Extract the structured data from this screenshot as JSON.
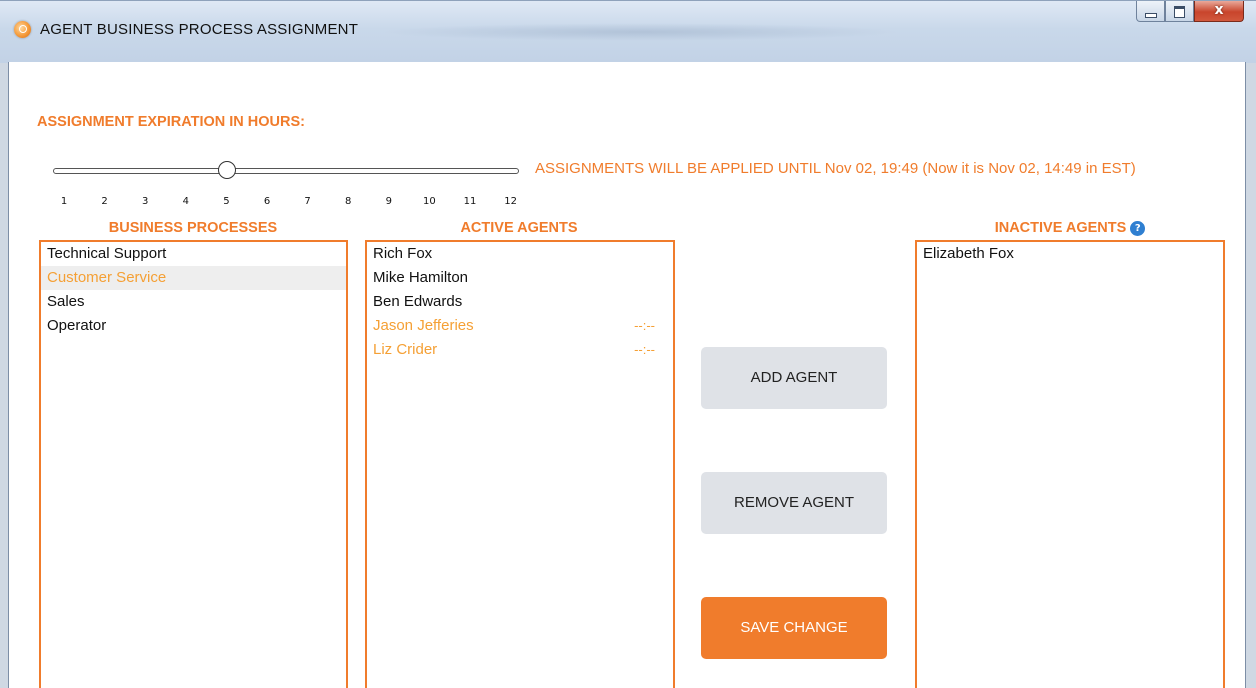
{
  "window": {
    "title": "AGENT BUSINESS PROCESS ASSIGNMENT",
    "close_glyph": "x"
  },
  "expiration": {
    "label": "ASSIGNMENT EXPIRATION IN HOURS:",
    "value_hours": 5,
    "tick_labels": [
      "1",
      "2",
      "3",
      "4",
      "5",
      "6",
      "7",
      "8",
      "9",
      "10",
      "11",
      "12"
    ],
    "applied_text": "ASSIGNMENTS WILL BE APPLIED UNTIL Nov 02, 19:49 (Now it is Nov 02, 14:49 in EST)"
  },
  "business_processes": {
    "title": "BUSINESS PROCESSES",
    "items": [
      "Technical Support",
      "Customer Service",
      "Sales",
      "Operator"
    ],
    "selected": "Customer Service"
  },
  "active_agents": {
    "title": "ACTIVE AGENTS",
    "items": [
      {
        "name": "Rich Fox",
        "time": ""
      },
      {
        "name": "Mike Hamilton",
        "time": ""
      },
      {
        "name": "Ben Edwards",
        "time": ""
      },
      {
        "name": "Jason Jefferies",
        "time": "--:--"
      },
      {
        "name": "Liz Crider",
        "time": "--:--"
      }
    ]
  },
  "inactive_agents": {
    "title": "INACTIVE AGENTS",
    "help_glyph": "?",
    "items": [
      "Elizabeth Fox"
    ]
  },
  "buttons": {
    "add": "ADD AGENT",
    "remove": "REMOVE AGENT",
    "save": "SAVE CHANGE"
  },
  "colors": {
    "accent": "#f07c2c",
    "pending": "#f5a035",
    "button_gray": "#dfe2e7"
  }
}
